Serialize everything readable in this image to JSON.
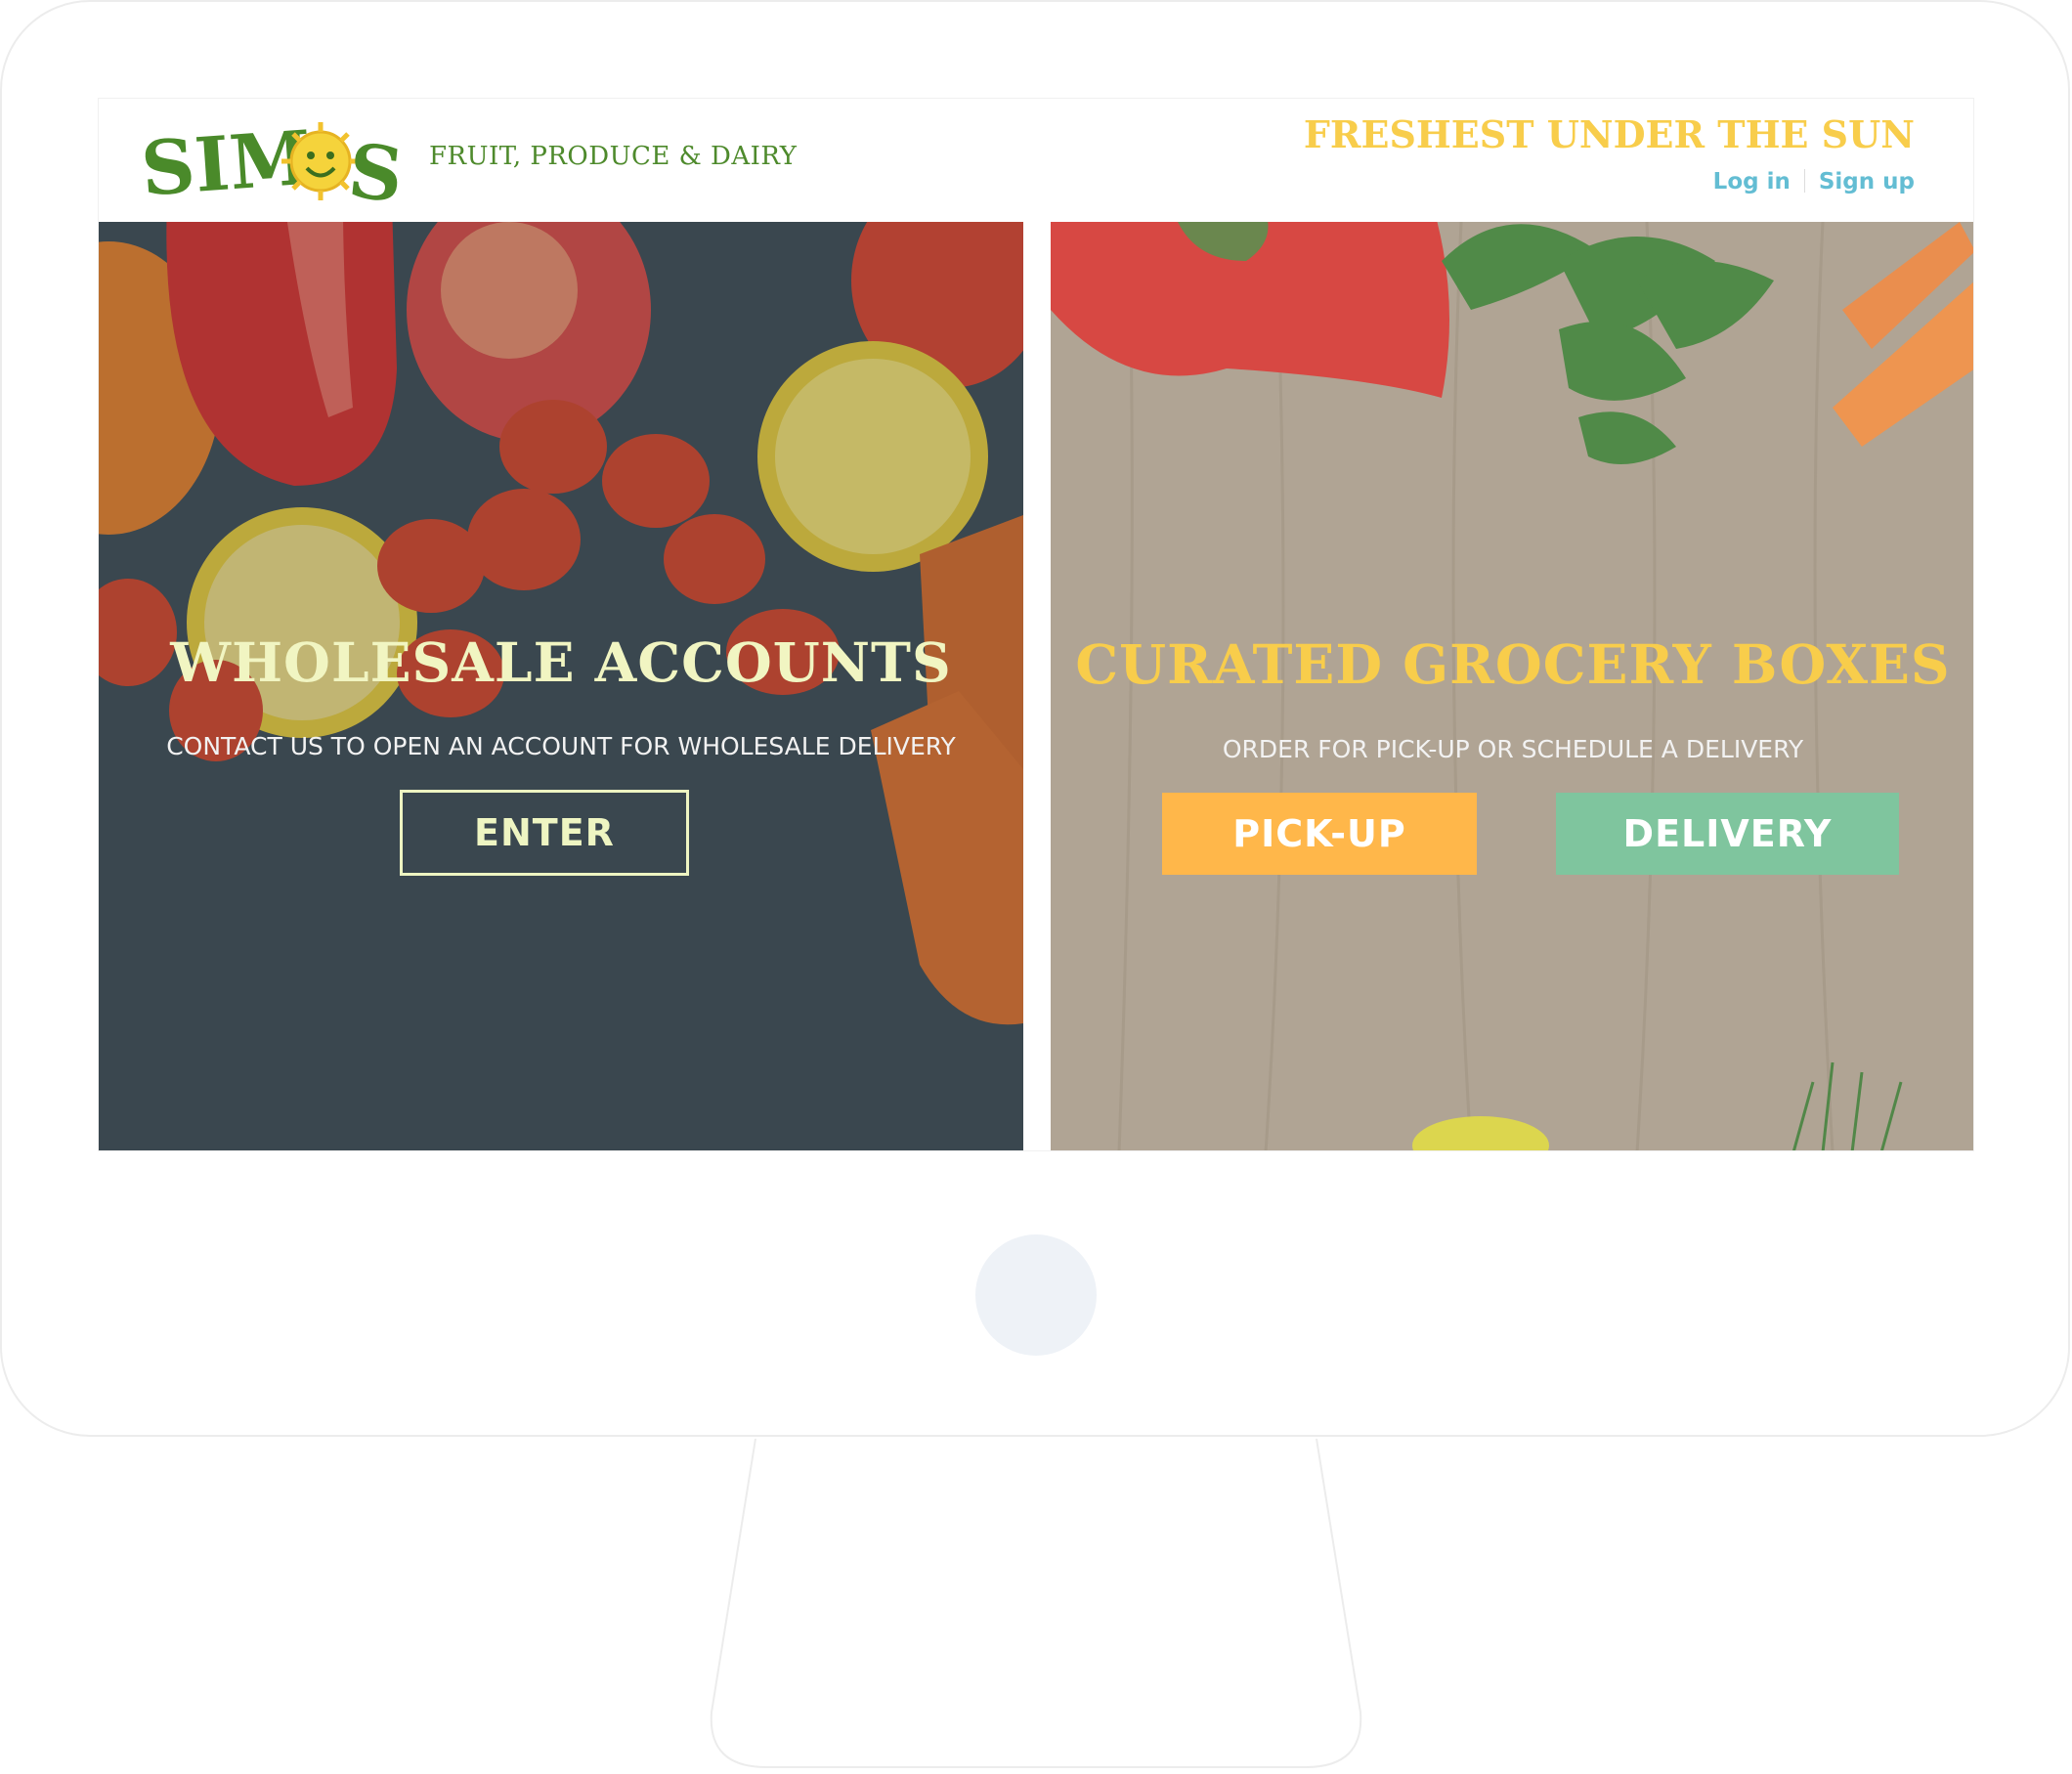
{
  "header": {
    "logo_text": "SIMOS",
    "tagline": "FRUIT, PRODUCE & DAIRY",
    "slogan": "FRESHEST UNDER THE SUN",
    "login_label": "Log in",
    "signup_label": "Sign up"
  },
  "wholesale": {
    "title": "WHOLESALE ACCOUNTS",
    "subtitle": "CONTACT US TO OPEN AN ACCOUNT FOR WHOLESALE DELIVERY",
    "enter_label": "ENTER"
  },
  "grocery": {
    "title": "CURATED GROCERY BOXES",
    "subtitle": "ORDER FOR PICK-UP OR SCHEDULE A DELIVERY",
    "pickup_label": "PICK-UP",
    "delivery_label": "DELIVERY"
  },
  "colors": {
    "brand_green": "#4e8a2c",
    "slogan_yellow": "#f8cd4b",
    "link_blue": "#63bdd3",
    "wholesale_title": "#f1f5c2",
    "grocery_title": "#f8cd4b",
    "pickup_bg": "#ffb74a",
    "delivery_bg": "#7fc59e",
    "enter_border": "#eef5c2"
  }
}
